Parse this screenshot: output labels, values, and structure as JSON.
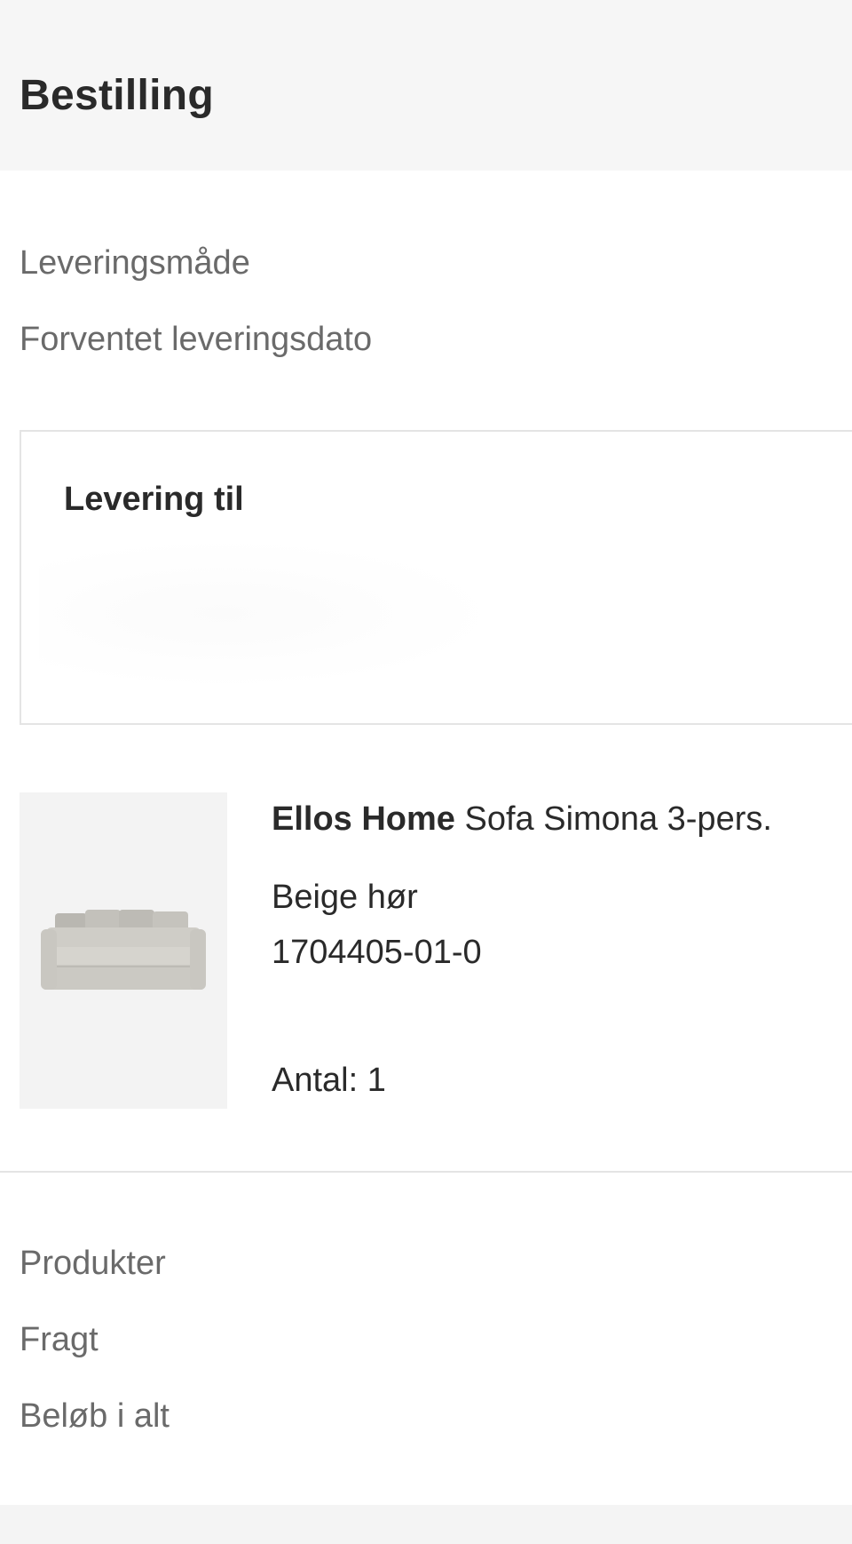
{
  "header": {
    "title": "Bestilling"
  },
  "delivery_meta": {
    "method_label": "Leveringsmåde",
    "expected_date_label": "Forventet leveringsdato"
  },
  "delivery_box": {
    "title": "Levering til"
  },
  "product": {
    "brand": "Ellos Home",
    "name": "Sofa Simona 3-pers.",
    "color": "Beige hør",
    "sku": "1704405-01-0",
    "quantity_text": "Antal: 1",
    "image_icon": "sofa-image"
  },
  "summary": {
    "products_label": "Produkter",
    "shipping_label": "Fragt",
    "total_label": "Beløb i alt"
  },
  "colors": {
    "header_bg": "#f6f6f6",
    "label_gray": "#6a6a6a",
    "text_dark": "#2a2a2a",
    "border": "#e4e4e4"
  }
}
